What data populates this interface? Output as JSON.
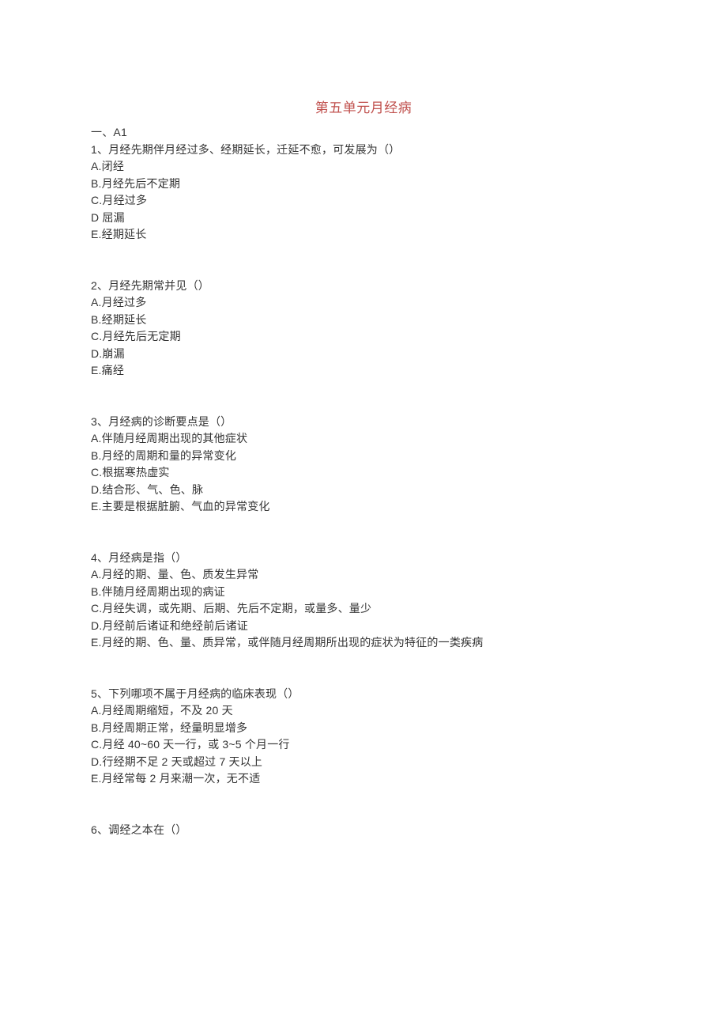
{
  "title": "第五单元月经病",
  "section_header": "一、A1",
  "questions": [
    {
      "stem": "1、月经先期伴月经过多、经期延长，迁延不愈，可发展为（）",
      "options": [
        "A.闭经",
        "B.月经先后不定期",
        "C.月经过多",
        "D 屈漏",
        "E.经期延长"
      ]
    },
    {
      "stem": "2、月经先期常并见（）",
      "options": [
        "A.月经过多",
        "B.经期延长",
        "C.月经先后无定期",
        "D.崩漏",
        "E.痛经"
      ]
    },
    {
      "stem": "3、月经病的诊断要点是（）",
      "options": [
        "A.伴随月经周期出现的其他症状",
        "B.月经的周期和量的异常变化",
        "C.根据寒热虚实",
        "D.结合形、气、色、脉",
        "E.主要是根据脏腑、气血的异常变化"
      ]
    },
    {
      "stem": "4、月经病是指（）",
      "options": [
        "A.月经的期、量、色、质发生异常",
        "B.伴随月经周期出现的病证",
        "C.月经失调，或先期、后期、先后不定期，或量多、量少",
        "D.月经前后诸证和绝经前后诸证",
        "E.月经的期、色、量、质异常，或伴随月经周期所出现的症状为特征的一类疾病"
      ]
    },
    {
      "stem": "5、下列哪项不属于月经病的临床表现（）",
      "options": [
        "A.月经周期缩短，不及 20 天",
        "B.月经周期正常，经量明显增多",
        "C.月经 40~60 天一行，或 3~5 个月一行",
        "D.行经期不足 2 天或超过 7 天以上",
        "E.月经常每 2 月来潮一次，无不适"
      ]
    },
    {
      "stem": "6、调经之本在（）",
      "options": []
    }
  ]
}
